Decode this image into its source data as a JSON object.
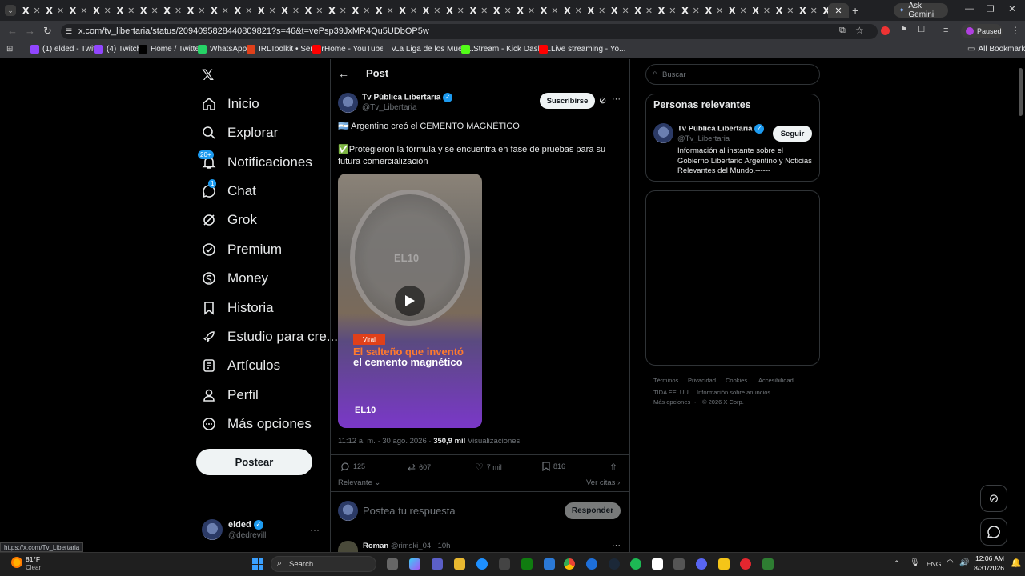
{
  "browser": {
    "tab_count": 35,
    "ask_gemini": "Ask Gemini",
    "url": "x.com/tv_libertaria/status/2094095828440809821?s=46&t=vePsp39JxMR4Qu5UDbOP5w",
    "paused_label": "Paused",
    "bookmarks": [
      {
        "label": "(1) elded - Twitch",
        "color": "#9146ff"
      },
      {
        "label": "(4) Twitch",
        "color": "#9146ff"
      },
      {
        "label": "Home / Twitter",
        "color": "#000000"
      },
      {
        "label": "WhatsApp",
        "color": "#25d366"
      },
      {
        "label": "IRLToolkit • Server",
        "color": "#e0401a"
      },
      {
        "label": "Home - YouTube TV",
        "color": "#ff0000"
      },
      {
        "label": "La Liga de los Muert...",
        "color": "#35363a"
      },
      {
        "label": "Stream - Kick Dashb...",
        "color": "#53fc18"
      },
      {
        "label": "Live streaming - Yo...",
        "color": "#ff0000"
      }
    ],
    "all_bookmarks": "All Bookmarks",
    "status_url": "https://x.com/Tv_Libertaria"
  },
  "nav": {
    "items": [
      {
        "label": "Inicio",
        "icon": "home-icon"
      },
      {
        "label": "Explorar",
        "icon": "search-icon"
      },
      {
        "label": "Notificaciones",
        "icon": "bell-icon",
        "badge": "20+"
      },
      {
        "label": "Chat",
        "icon": "chat-icon",
        "badge": "1"
      },
      {
        "label": "Grok",
        "icon": "grok-icon"
      },
      {
        "label": "Premium",
        "icon": "premium-icon"
      },
      {
        "label": "Money",
        "icon": "money-icon"
      },
      {
        "label": "Historia",
        "icon": "bookmark-icon"
      },
      {
        "label": "Estudio para cre...",
        "icon": "rocket-icon"
      },
      {
        "label": "Artículos",
        "icon": "article-icon"
      },
      {
        "label": "Perfil",
        "icon": "person-icon"
      },
      {
        "label": "Más opciones",
        "icon": "more-icon"
      }
    ],
    "post_button": "Postear",
    "account": {
      "name": "elded",
      "handle": "@dedrevill"
    }
  },
  "post": {
    "header_title": "Post",
    "author_name": "Tv Pública Libertaria",
    "author_handle": "@Tv_Libertaria",
    "subscribe": "Suscribirse",
    "line1": "🇦🇷 Argentino creó el CEMENTO MAGNÉTICO",
    "line2": "✅Protegieron la fórmula y se encuentra en fase de pruebas para su futura comercialización",
    "video": {
      "watermark": "EL10",
      "tag": "Viral",
      "headline_orange": "El salteño que inventó",
      "headline_white": "el cemento magnético",
      "logo": "EL10"
    },
    "meta_time": "11:12 a. m. · 30 ago. 2026 ·",
    "views_count": "350,9 mil",
    "views_label": "Visualizaciones",
    "replies": "125",
    "reposts": "607",
    "likes": "7 mil",
    "bookmarks": "816",
    "sort_label": "Relevante",
    "quotes_label": "Ver citas",
    "reply_placeholder": "Postea tu respuesta",
    "reply_button": "Responder",
    "next_reply": {
      "name": "Roman",
      "handle": "@rimski_04",
      "time": "· 10h"
    }
  },
  "sidebar": {
    "search_placeholder": "Buscar",
    "relevant_title": "Personas relevantes",
    "person": {
      "name": "Tv Pública Libertaria",
      "handle": "@Tv_Libertaria",
      "follow": "Seguir",
      "bio": "Información al instante sobre el Gobierno Libertario Argentino y Noticias Relevantes del Mundo.------"
    },
    "footer": [
      "Términos",
      "Privacidad",
      "Cookies",
      "Accesibilidad",
      "TIDA EE. UU.",
      "Información sobre anuncios",
      "Más opciones ···",
      "© 2026 X Corp."
    ]
  },
  "taskbar": {
    "weather_temp": "81°F",
    "weather_desc": "Clear",
    "search": "Search",
    "lang": "ENG",
    "time": "12:06 AM",
    "date": "8/31/2026"
  }
}
